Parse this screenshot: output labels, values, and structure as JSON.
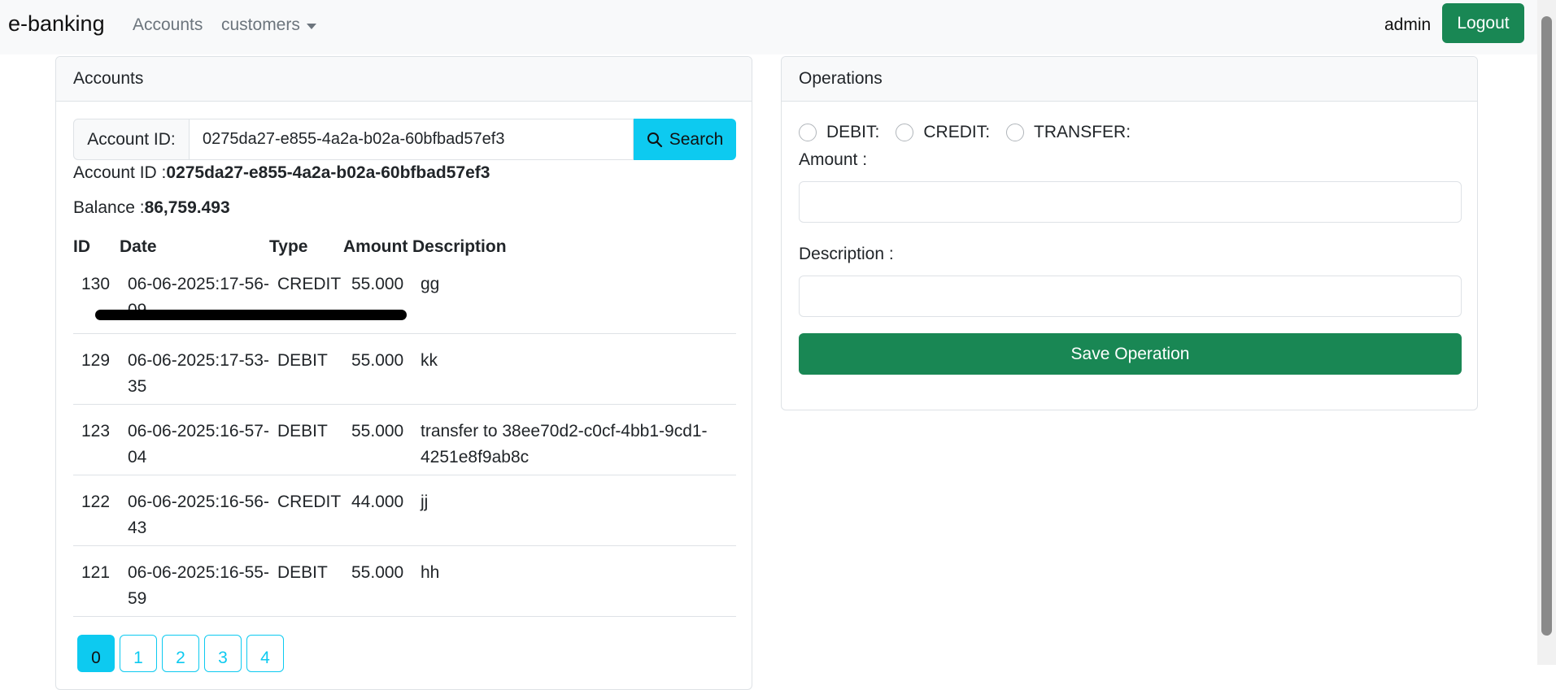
{
  "navbar": {
    "brand": "e-banking",
    "accounts_link": "Accounts",
    "customers_link": "customers",
    "username": "admin",
    "logout_label": "Logout"
  },
  "accounts_card": {
    "title": "Accounts",
    "search_label": "Account ID:",
    "search_value": "0275da27-e855-4a2a-b02a-60bfbad57ef3",
    "search_button": "Search",
    "account_id_label": "Account ID :",
    "account_id_value": "0275da27-e855-4a2a-b02a-60bfbad57ef3",
    "balance_label": "Balance :",
    "balance_value": "86,759.493",
    "table": {
      "headers": [
        "ID",
        "Date",
        "Type",
        "Amount",
        "Description"
      ],
      "rows": [
        {
          "id": "130",
          "date": "06-06-2025:17-56-09",
          "type": "CREDIT",
          "amount": "55.000",
          "description": "gg"
        },
        {
          "id": "129",
          "date": "06-06-2025:17-53-35",
          "type": "DEBIT",
          "amount": "55.000",
          "description": "kk"
        },
        {
          "id": "123",
          "date": "06-06-2025:16-57-04",
          "type": "DEBIT",
          "amount": "55.000",
          "description": "transfer to 38ee70d2-c0cf-4bb1-9cd1-4251e8f9ab8c"
        },
        {
          "id": "122",
          "date": "06-06-2025:16-56-43",
          "type": "CREDIT",
          "amount": "44.000",
          "description": "jj"
        },
        {
          "id": "121",
          "date": "06-06-2025:16-55-59",
          "type": "DEBIT",
          "amount": "55.000",
          "description": "hh"
        }
      ]
    },
    "pages": [
      "0",
      "1",
      "2",
      "3",
      "4"
    ],
    "active_page": "0"
  },
  "operations_card": {
    "title": "Operations",
    "radio_options": [
      "DEBIT:",
      "CREDIT:",
      "TRANSFER:"
    ],
    "amount_label": "Amount :",
    "description_label": "Description :",
    "save_button": "Save Operation"
  },
  "colors": {
    "primary_green": "#198754",
    "info_cyan": "#0dcaf0",
    "navbar_bg": "#f8f9fa"
  }
}
